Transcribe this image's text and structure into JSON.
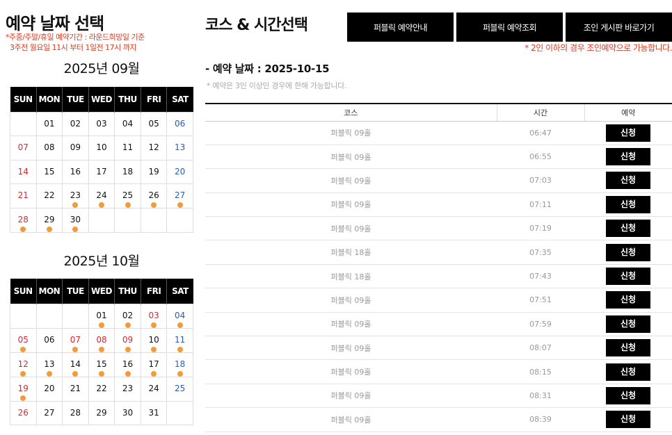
{
  "left": {
    "title": "예약 날짜 선택",
    "notice_line1": "*주중/주말/휴일 예약기간 : 라운드희망일 기준",
    "notice_line2": "3주전 월요일 11시 부터 1일전 17시 까지"
  },
  "weekdays": [
    "SUN",
    "MON",
    "TUE",
    "WED",
    "THU",
    "FRI",
    "SAT"
  ],
  "calendars": [
    {
      "title": "2025년 09월",
      "weeks": [
        [
          {
            "d": ""
          },
          {
            "d": "01"
          },
          {
            "d": "02"
          },
          {
            "d": "03"
          },
          {
            "d": "04"
          },
          {
            "d": "05"
          },
          {
            "d": "06"
          }
        ],
        [
          {
            "d": "07"
          },
          {
            "d": "08"
          },
          {
            "d": "09"
          },
          {
            "d": "10"
          },
          {
            "d": "11"
          },
          {
            "d": "12"
          },
          {
            "d": "13"
          }
        ],
        [
          {
            "d": "14"
          },
          {
            "d": "15"
          },
          {
            "d": "16"
          },
          {
            "d": "17"
          },
          {
            "d": "18"
          },
          {
            "d": "19"
          },
          {
            "d": "20"
          }
        ],
        [
          {
            "d": "21"
          },
          {
            "d": "22"
          },
          {
            "d": "23",
            "dot": true
          },
          {
            "d": "24",
            "dot": true
          },
          {
            "d": "25",
            "dot": true
          },
          {
            "d": "26",
            "dot": true
          },
          {
            "d": "27",
            "dot": true
          }
        ],
        [
          {
            "d": "28",
            "dot": true
          },
          {
            "d": "29",
            "dot": true
          },
          {
            "d": "30",
            "dot": true
          },
          {
            "d": ""
          },
          {
            "d": ""
          },
          {
            "d": ""
          },
          {
            "d": ""
          }
        ]
      ]
    },
    {
      "title": "2025년 10월",
      "weeks": [
        [
          {
            "d": ""
          },
          {
            "d": ""
          },
          {
            "d": ""
          },
          {
            "d": "01",
            "dot": true
          },
          {
            "d": "02",
            "dot": true
          },
          {
            "d": "03",
            "dot": true,
            "hol": true
          },
          {
            "d": "04",
            "dot": true
          }
        ],
        [
          {
            "d": "05",
            "dot": true
          },
          {
            "d": "06"
          },
          {
            "d": "07",
            "dot": true,
            "hol": true
          },
          {
            "d": "08",
            "dot": true,
            "hol": true
          },
          {
            "d": "09",
            "dot": true,
            "hol": true
          },
          {
            "d": "10",
            "dot": true
          },
          {
            "d": "11",
            "dot": true
          }
        ],
        [
          {
            "d": "12",
            "dot": true
          },
          {
            "d": "13",
            "dot": true
          },
          {
            "d": "14",
            "dot": true
          },
          {
            "d": "15",
            "dot": true
          },
          {
            "d": "16",
            "dot": true
          },
          {
            "d": "17",
            "dot": true
          },
          {
            "d": "18",
            "dot": true
          }
        ],
        [
          {
            "d": "19",
            "dot": true
          },
          {
            "d": "20"
          },
          {
            "d": "21"
          },
          {
            "d": "22"
          },
          {
            "d": "23"
          },
          {
            "d": "24"
          },
          {
            "d": "25"
          }
        ],
        [
          {
            "d": "26"
          },
          {
            "d": "27"
          },
          {
            "d": "28"
          },
          {
            "d": "29"
          },
          {
            "d": "30"
          },
          {
            "d": "31"
          },
          {
            "d": ""
          }
        ]
      ]
    }
  ],
  "right": {
    "title": "코스 & 시간선택",
    "buttons": [
      "퍼블릭 예약안내",
      "퍼블릭 예약조회",
      "조인 게시판 바로가기"
    ],
    "notice": "* 2인 이하의 경우 조인예약으로 가능합니다.",
    "selected_date": "- 예약 날짜 : 2025-10-15",
    "note": "*   예약은 3인 이상인 경우에 한해 가능합니다."
  },
  "table": {
    "headers": [
      "코스",
      "시간",
      "예약"
    ],
    "apply_label": "신청",
    "rows": [
      {
        "course": "퍼블릭 09홀",
        "time": "06:47"
      },
      {
        "course": "퍼블릭 09홀",
        "time": "06:55"
      },
      {
        "course": "퍼블릭 09홀",
        "time": "07:03"
      },
      {
        "course": "퍼블릭 09홀",
        "time": "07:11"
      },
      {
        "course": "퍼블릭 09홀",
        "time": "07:19"
      },
      {
        "course": "퍼블릭 18홀",
        "time": "07:35"
      },
      {
        "course": "퍼블릭 18홀",
        "time": "07:43"
      },
      {
        "course": "퍼블릭 09홀",
        "time": "07:51"
      },
      {
        "course": "퍼블릭 09홀",
        "time": "07:59"
      },
      {
        "course": "퍼블릭 09홀",
        "time": "08:07"
      },
      {
        "course": "퍼블릭 09홀",
        "time": "08:15"
      },
      {
        "course": "퍼블릭 09홀",
        "time": "08:31"
      },
      {
        "course": "퍼블릭 09홀",
        "time": "08:39"
      }
    ]
  },
  "colors": {
    "accent_red": "#e03a1e",
    "sunday": "#d9262c",
    "saturday": "#2a5dab",
    "available_dot": "#f39a3c",
    "button_bg": "#000000"
  }
}
